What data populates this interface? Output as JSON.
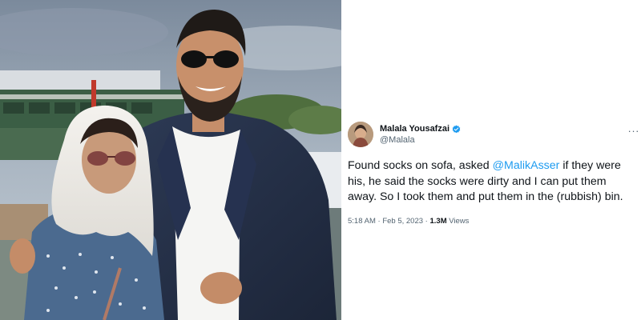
{
  "tweet": {
    "display_name": "Malala Yousafzai",
    "handle": "@Malala",
    "verified_icon": "verified-badge-icon",
    "more_icon": "more-options-icon",
    "more_glyph": "···",
    "text_before": "Found socks on sofa, asked ",
    "mention": "@MalikAsser",
    "text_after": " if they were his, he said the socks were dirty and I can put them away. So I took them and put them in the (rubbish) bin.",
    "time": "5:18 AM",
    "separator": "·",
    "date": "Feb 5, 2023",
    "views_count": "1.3M",
    "views_label": "Views"
  },
  "colors": {
    "accent": "#1d9bf0",
    "text": "#0f1419",
    "secondary": "#536471"
  }
}
